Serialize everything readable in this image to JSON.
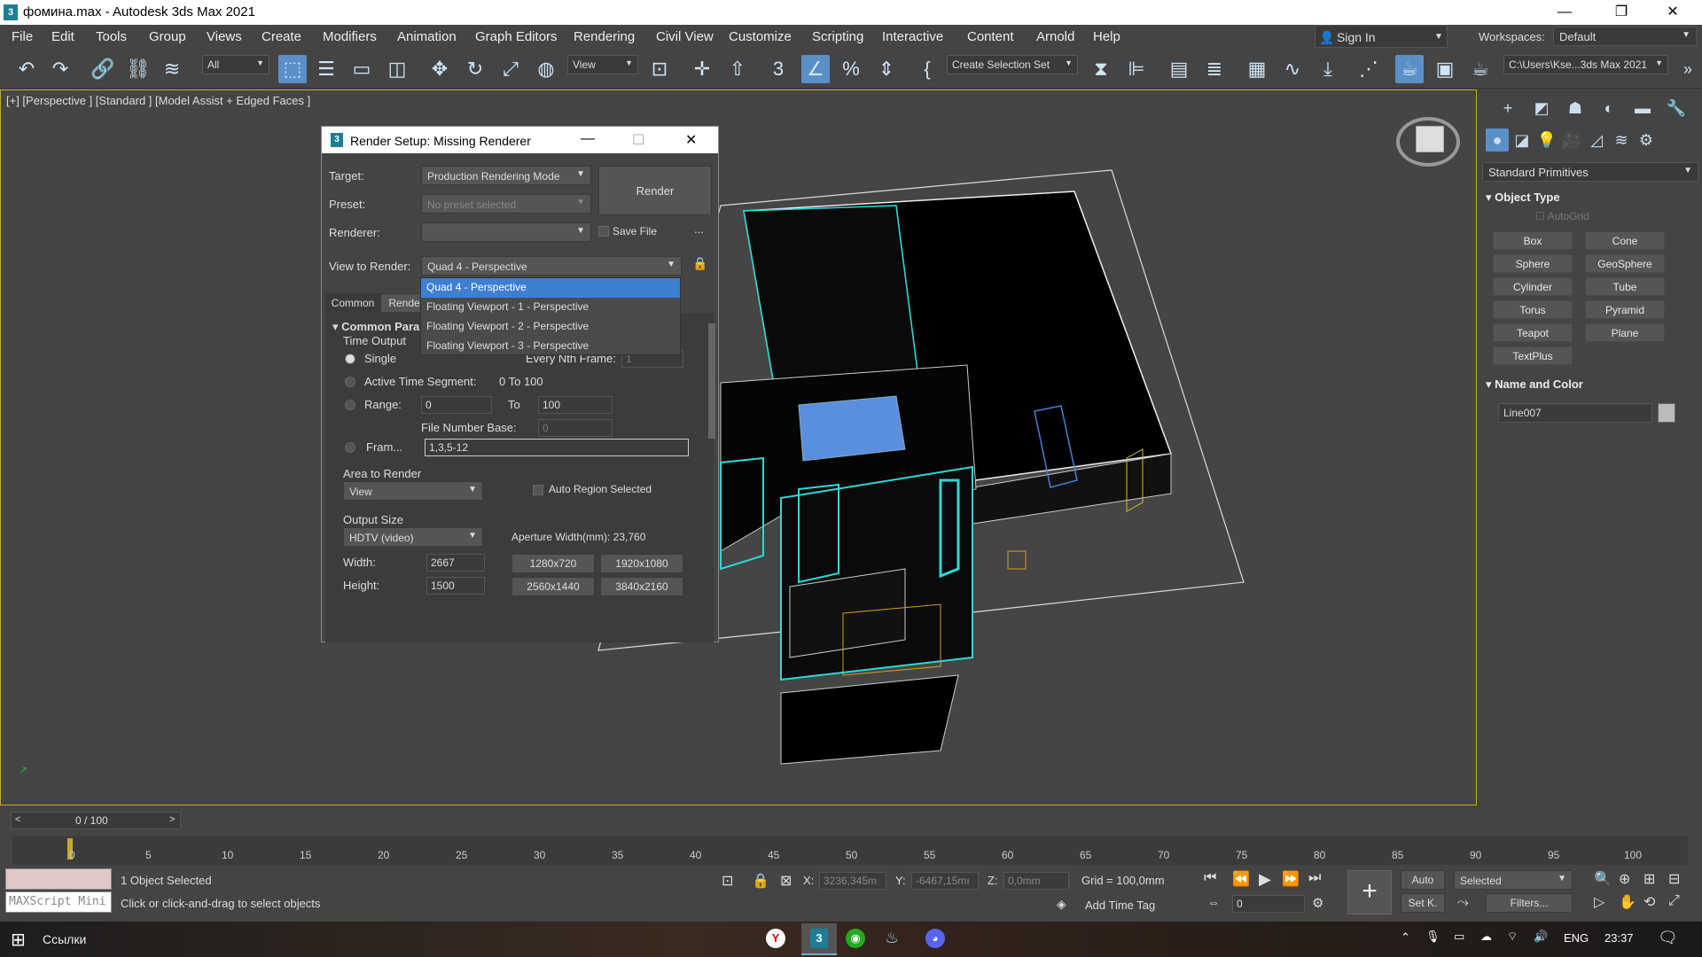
{
  "titlebar": {
    "icon": "3",
    "title": "фомина.max - Autodesk 3ds Max 2021",
    "min": "—",
    "restore": "❐",
    "close": "✕"
  },
  "menu": [
    "File",
    "Edit",
    "Tools",
    "Group",
    "Views",
    "Create",
    "Modifiers",
    "Animation",
    "Graph Editors",
    "Rendering",
    "Civil View",
    "Customize",
    "Scripting",
    "Interactive",
    "Content",
    "Arnold",
    "Help"
  ],
  "signin": {
    "label": "Sign In"
  },
  "workspaces": {
    "label": "Workspaces:",
    "value": "Default"
  },
  "toolbar": {
    "filter": "All",
    "refcoord": "View",
    "selection_set": "Create Selection Set",
    "path": "C:\\Users\\Kse...3ds Max 2021"
  },
  "viewport": {
    "label": "[+] [Perspective ] [Standard ] [Model Assist + Edged Faces ]"
  },
  "cmdpanel": {
    "category": "Standard Primitives",
    "object_type": "Object Type",
    "autogrid": "AutoGrid",
    "buttons": [
      "Box",
      "Cone",
      "Sphere",
      "GeoSphere",
      "Cylinder",
      "Tube",
      "Torus",
      "Pyramid",
      "Teapot",
      "Plane",
      "TextPlus"
    ],
    "name_color": "Name and Color",
    "object_name": "Line007"
  },
  "dialog": {
    "title": "Render Setup: Missing Renderer",
    "target_label": "Target:",
    "target_value": "Production Rendering Mode",
    "preset_label": "Preset:",
    "preset_value": "No preset selected",
    "renderer_label": "Renderer:",
    "renderer_value": "",
    "save_file": "Save File",
    "ellipsis": "...",
    "render_button": "Render",
    "view_label": "View to Render:",
    "view_value": "Quad 4 - Perspective",
    "dropdown_options": [
      "Quad 4 - Perspective",
      "Floating Viewport - 1 - Perspective",
      "Floating Viewport - 2 - Perspective",
      "Floating Viewport - 3 - Perspective"
    ],
    "tabs": [
      "Common",
      "Rende"
    ],
    "rollout": "Common Para",
    "time_output": "Time Output",
    "single": "Single",
    "every_nth": "Every Nth Frame:",
    "every_nth_value": "1",
    "active_segment": "Active Time Segment:",
    "active_segment_value": "0 To 100",
    "range": "Range:",
    "range_from": "0",
    "range_to_label": "To",
    "range_to": "100",
    "file_number_base": "File Number Base:",
    "file_number_base_value": "0",
    "frames": "Fram...",
    "frames_value": "1,3,5-12",
    "area_to_render": "Area to Render",
    "area_value": "View",
    "auto_region": "Auto Region Selected",
    "output_size": "Output Size",
    "output_value": "HDTV (video)",
    "aperture": "Aperture Width(mm): 23,760",
    "width_label": "Width:",
    "width_value": "2667",
    "height_label": "Height:",
    "height_value": "1500",
    "presets": [
      "1280x720",
      "1920x1080",
      "2560x1440",
      "3840x2160"
    ]
  },
  "timeline": {
    "frame": "0 / 100",
    "ticks": [
      "0",
      "5",
      "10",
      "15",
      "20",
      "25",
      "30",
      "35",
      "40",
      "45",
      "50",
      "55",
      "60",
      "65",
      "70",
      "75",
      "80",
      "85",
      "90",
      "95",
      "100"
    ]
  },
  "status": {
    "selected": "1 Object Selected",
    "hint": "Click or click-and-drag to select objects",
    "maxscript": "MAXScript Mini",
    "x_label": "X:",
    "x": "3236,345m",
    "y_label": "Y:",
    "y": "-6467,15mı",
    "z_label": "Z:",
    "z": "0,0mm",
    "grid": "Grid = 100,0mm",
    "add_time_tag": "Add Time Tag",
    "auto": "Auto",
    "selected_dd": "Selected",
    "setk": "Set K.",
    "filters": "Filters...",
    "frame_field": "0"
  },
  "taskbar": {
    "links": "Ссылки",
    "lang": "ENG",
    "time": "23:37"
  }
}
